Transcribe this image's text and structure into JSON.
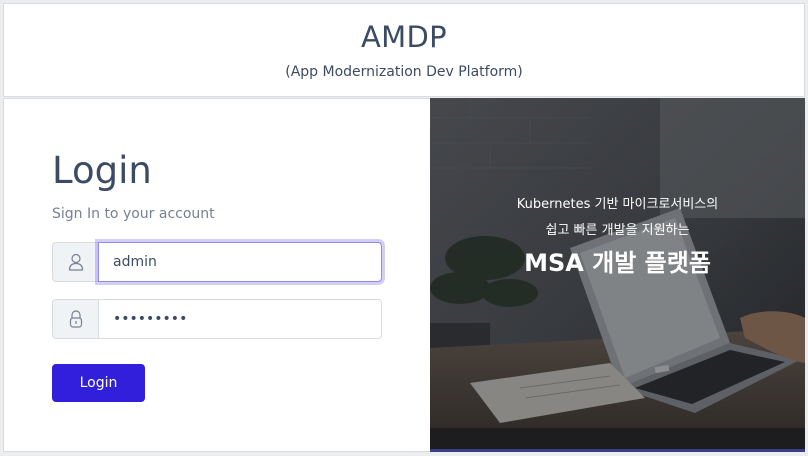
{
  "header": {
    "title": "AMDP",
    "subtitle": "(App Modernization Dev Platform)"
  },
  "login": {
    "title": "Login",
    "subtitle": "Sign In to your account",
    "username": {
      "value": "admin",
      "icon": "user-icon"
    },
    "password": {
      "value": "•••••••••",
      "icon": "lock-icon"
    },
    "button_label": "Login"
  },
  "hero": {
    "line1": "Kubernetes 기반 마이크로서비스의",
    "line2": "쉽고 빠른 개발을 지원하는",
    "line3": "MSA 개발 플랫폼"
  },
  "colors": {
    "primary": "#321fdb",
    "text": "#3c4b64",
    "muted": "#768192",
    "border": "#d8dbe0"
  }
}
